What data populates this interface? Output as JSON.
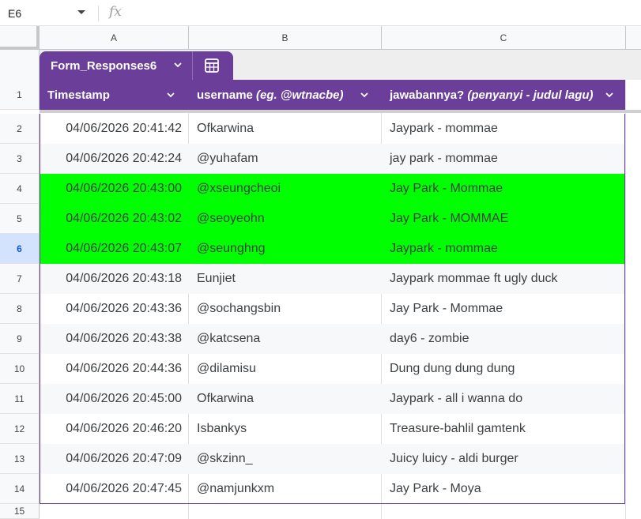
{
  "formula_bar": {
    "cell_ref": "E6",
    "fx_label": "fx"
  },
  "columns": [
    "A",
    "B",
    "C"
  ],
  "row_numbers": [
    "1",
    "2",
    "3",
    "4",
    "5",
    "6",
    "7",
    "8",
    "9",
    "10",
    "11",
    "12",
    "13",
    "14",
    "15"
  ],
  "active_row": "6",
  "table": {
    "name": "Form_Responses6",
    "header_color": "#6b3f99",
    "highlight_color": "#00ff00",
    "headers": [
      {
        "label": "Timestamp"
      },
      {
        "label_plain": "username ",
        "label_italic": "(eg. @wtnacbe)"
      },
      {
        "label_plain": "jawabannya? ",
        "label_italic": "(penyanyi - judul lagu)"
      }
    ],
    "rows": [
      {
        "timestamp": "04/06/2026 20:41:42",
        "username": "Ofkarwina",
        "answer": "Jaypark - mommae",
        "highlighted": false
      },
      {
        "timestamp": "04/06/2026 20:42:24",
        "username": "@yuhafam",
        "answer": "jay park - mommae",
        "highlighted": false
      },
      {
        "timestamp": "04/06/2026 20:43:00",
        "username": "@xseungcheoi",
        "answer": "Jay Park - Mommae",
        "highlighted": true
      },
      {
        "timestamp": "04/06/2026 20:43:02",
        "username": "@seoyeohn",
        "answer": "Jay Park - MOMMAE",
        "highlighted": true
      },
      {
        "timestamp": "04/06/2026 20:43:07",
        "username": "@seunghng",
        "answer": "Jaypark - mommae",
        "highlighted": true
      },
      {
        "timestamp": "04/06/2026 20:43:18",
        "username": "Eunjiet",
        "answer": "Jaypark mommae ft ugly duck",
        "highlighted": false
      },
      {
        "timestamp": "04/06/2026 20:43:36",
        "username": "@sochangsbin",
        "answer": "Jay Park - Mommae",
        "highlighted": false
      },
      {
        "timestamp": "04/06/2026 20:43:38",
        "username": "@katcsena",
        "answer": "day6 - zombie",
        "highlighted": false
      },
      {
        "timestamp": "04/06/2026 20:44:36",
        "username": "@dilamisu",
        "answer": "Dung dung dung dung",
        "highlighted": false
      },
      {
        "timestamp": "04/06/2026 20:45:00",
        "username": "Ofkarwina",
        "answer": "Jaypark - all i wanna do",
        "highlighted": false
      },
      {
        "timestamp": "04/06/2026 20:46:20",
        "username": "Isbankys",
        "answer": "Treasure-bahlil gamtenk",
        "highlighted": false
      },
      {
        "timestamp": "04/06/2026 20:47:09",
        "username": "@skzinn_",
        "answer": "Juicy luicy - aldi burger",
        "highlighted": false
      },
      {
        "timestamp": "04/06/2026 20:47:45",
        "username": "@namjunkxm",
        "answer": "Jay Park - Moya",
        "highlighted": false
      }
    ]
  }
}
